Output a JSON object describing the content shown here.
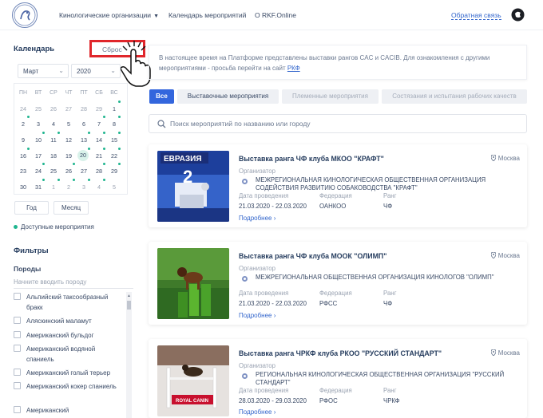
{
  "header": {
    "nav": [
      {
        "label": "Кинологические организации",
        "has_dropdown": true
      },
      {
        "label": "Календарь мероприятий",
        "has_dropdown": false
      },
      {
        "label": "О RKF.Online",
        "has_dropdown": false
      }
    ],
    "feedback_label": "Обратная связь",
    "logo_icon": "rkf-logo-icon",
    "user_icon": "user-icon"
  },
  "calendar": {
    "title": "Календарь",
    "reset_label": "Сброс",
    "month": "Март",
    "year": "2020",
    "weekdays": [
      "ПН",
      "ВТ",
      "СР",
      "ЧТ",
      "ПТ",
      "СБ",
      "ВС"
    ],
    "weeks": [
      [
        {
          "d": "24",
          "m": true
        },
        {
          "d": "25",
          "m": true
        },
        {
          "d": "26",
          "m": true
        },
        {
          "d": "27",
          "m": true
        },
        {
          "d": "28",
          "m": true
        },
        {
          "d": "29",
          "m": true
        },
        {
          "d": "1"
        }
      ],
      [
        {
          "d": "2"
        },
        {
          "d": "3"
        },
        {
          "d": "4"
        },
        {
          "d": "5"
        },
        {
          "d": "6"
        },
        {
          "d": "7"
        },
        {
          "d": "8"
        }
      ],
      [
        {
          "d": "9"
        },
        {
          "d": "10"
        },
        {
          "d": "11"
        },
        {
          "d": "12"
        },
        {
          "d": "13"
        },
        {
          "d": "14"
        },
        {
          "d": "15"
        }
      ],
      [
        {
          "d": "16"
        },
        {
          "d": "17"
        },
        {
          "d": "18"
        },
        {
          "d": "19"
        },
        {
          "d": "20",
          "today": true
        },
        {
          "d": "21"
        },
        {
          "d": "22"
        }
      ],
      [
        {
          "d": "23"
        },
        {
          "d": "24"
        },
        {
          "d": "25"
        },
        {
          "d": "26"
        },
        {
          "d": "27"
        },
        {
          "d": "28"
        },
        {
          "d": "29"
        }
      ],
      [
        {
          "d": "30"
        },
        {
          "d": "31"
        },
        {
          "d": "1",
          "m": true
        },
        {
          "d": "2",
          "m": true
        },
        {
          "d": "3",
          "m": true
        },
        {
          "d": "4",
          "m": true
        },
        {
          "d": "5",
          "m": true
        }
      ]
    ],
    "event_dots": [
      [
        0,
        6
      ],
      [
        1,
        5
      ],
      [
        1,
        6
      ],
      [
        2,
        1
      ],
      [
        2,
        2
      ],
      [
        2,
        4
      ],
      [
        2,
        5
      ],
      [
        2,
        6
      ],
      [
        3,
        0
      ],
      [
        3,
        4
      ],
      [
        3,
        5
      ],
      [
        3,
        6
      ],
      [
        4,
        1
      ],
      [
        4,
        3
      ],
      [
        4,
        5
      ],
      [
        4,
        6
      ],
      [
        5,
        1
      ],
      [
        5,
        2
      ],
      [
        5,
        3
      ],
      [
        5,
        4
      ],
      [
        5,
        5
      ],
      [
        1,
        0
      ]
    ],
    "buttons": [
      "Год",
      "Месяц"
    ],
    "legend": "Доступные мероприятия",
    "accent_color": "#1fb58f"
  },
  "filters": {
    "title": "Фильтры",
    "breeds_title": "Породы",
    "breed_placeholder": "Начните вводить породу",
    "breeds": [
      "Альпийский таксообразный бракк",
      "Аляскинский маламут",
      "Американский бульдог",
      "Американский водяной спаниель",
      "Американский голый терьер",
      "Американский кокер спаниель",
      "Американский"
    ]
  },
  "notice": {
    "text": "В настоящее время на Платформе представлены выставки рангов CAC и CACIB. Для ознакомления с другими мероприятиями - просьба перейти на сайт ",
    "link": "РКФ"
  },
  "tabs": [
    {
      "label": "Все",
      "state": "active"
    },
    {
      "label": "Выставочные мероприятия",
      "state": "normal"
    },
    {
      "label": "Племенные мероприятия",
      "state": "disabled"
    },
    {
      "label": "Состязания и испытания рабочих качеств",
      "state": "disabled"
    }
  ],
  "search": {
    "placeholder": "Поиск мероприятий по названию или городу"
  },
  "labels": {
    "organizer": "Организатор",
    "dates": "Дата проведения",
    "federation": "Федерация",
    "rank": "Ранг",
    "more": "Подробнее"
  },
  "events": [
    {
      "title": "Выставка ранга ЧФ клуба МКОО \"КРАФТ\"",
      "city": "Москва",
      "organizer": "МЕЖРЕГИОНАЛЬНАЯ КИНОЛОГИЧЕСКАЯ ОБЩЕСТВЕННАЯ ОРГАНИЗАЦИЯ СОДЕЙСТВИЯ РАЗВИТИЮ СОБАКОВОДСТВА \"КРАФТ\"",
      "dates": "21.03.2020 - 22.03.2020",
      "federation": "ОАНКОО",
      "rank": "ЧФ",
      "image_text": "ЕВРАЗИЯ"
    },
    {
      "title": "Выставка ранга ЧФ клуба МООК \"ОЛИМП\"",
      "city": "Москва",
      "organizer": "МЕЖРЕГИОНАЛЬНАЯ ОБЩЕСТВЕННАЯ ОРГАНИЗАЦИЯ КИНОЛОГОВ \"ОЛИМП\"",
      "dates": "21.03.2020 - 22.03.2020",
      "federation": "РФСС",
      "rank": "ЧФ",
      "image_text": ""
    },
    {
      "title": "Выставка ранга ЧРКФ клуба РКОО \"РУССКИЙ СТАНДАРТ\"",
      "city": "Москва",
      "organizer": "РЕГИОНАЛЬНАЯ КИНОЛОГИЧЕСКАЯ ОБЩЕСТВЕННАЯ ОРГАНИЗАЦИЯ \"РУССКИЙ СТАНДАРТ\"",
      "dates": "28.03.2020 - 29.03.2020",
      "federation": "РФОС",
      "rank": "ЧРКФ",
      "image_text": "ROYAL CANIN"
    }
  ]
}
